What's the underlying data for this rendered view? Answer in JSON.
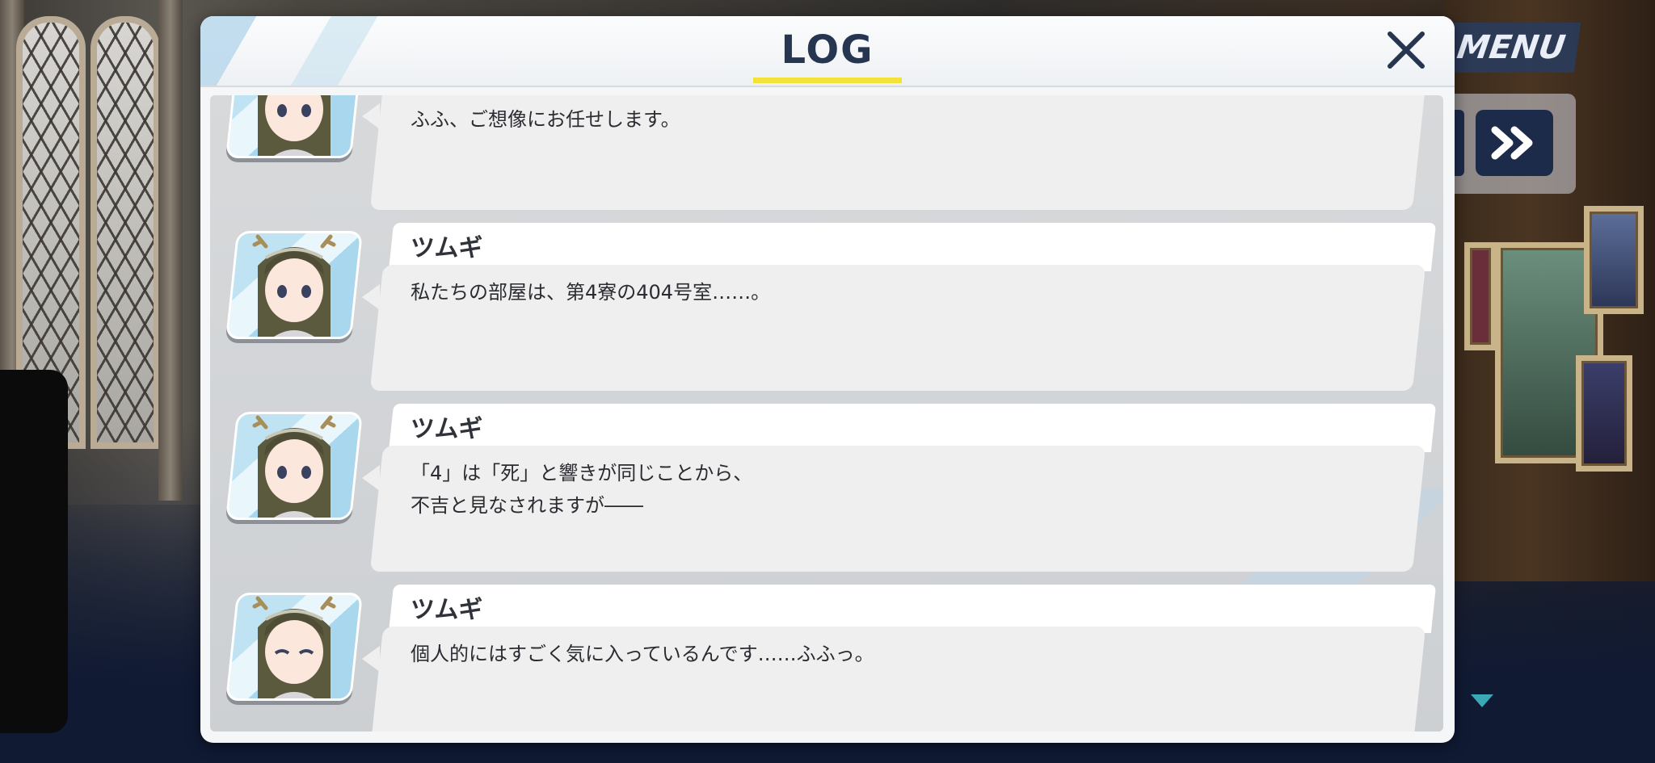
{
  "hud": {
    "menu_label": "MENU",
    "skip_icon": "fast-forward-icon",
    "scroll_down_icon": "down-triangle-icon"
  },
  "log": {
    "title": "LOG",
    "close_icon": "close-icon",
    "accent_color": "#f2e33a",
    "entries": [
      {
        "speaker": "",
        "lines": [
          "ふふ、ご想像にお任せします。"
        ]
      },
      {
        "speaker": "ツムギ",
        "lines": [
          "私たちの部屋は、第4寮の404号室……。"
        ]
      },
      {
        "speaker": "ツムギ",
        "lines": [
          "「4」は「死」と響きが同じことから、",
          "不吉と見なされますが――"
        ]
      },
      {
        "speaker": "ツムギ",
        "lines": [
          "個人的にはすごく気に入っているんです……ふふっ。"
        ]
      }
    ]
  }
}
